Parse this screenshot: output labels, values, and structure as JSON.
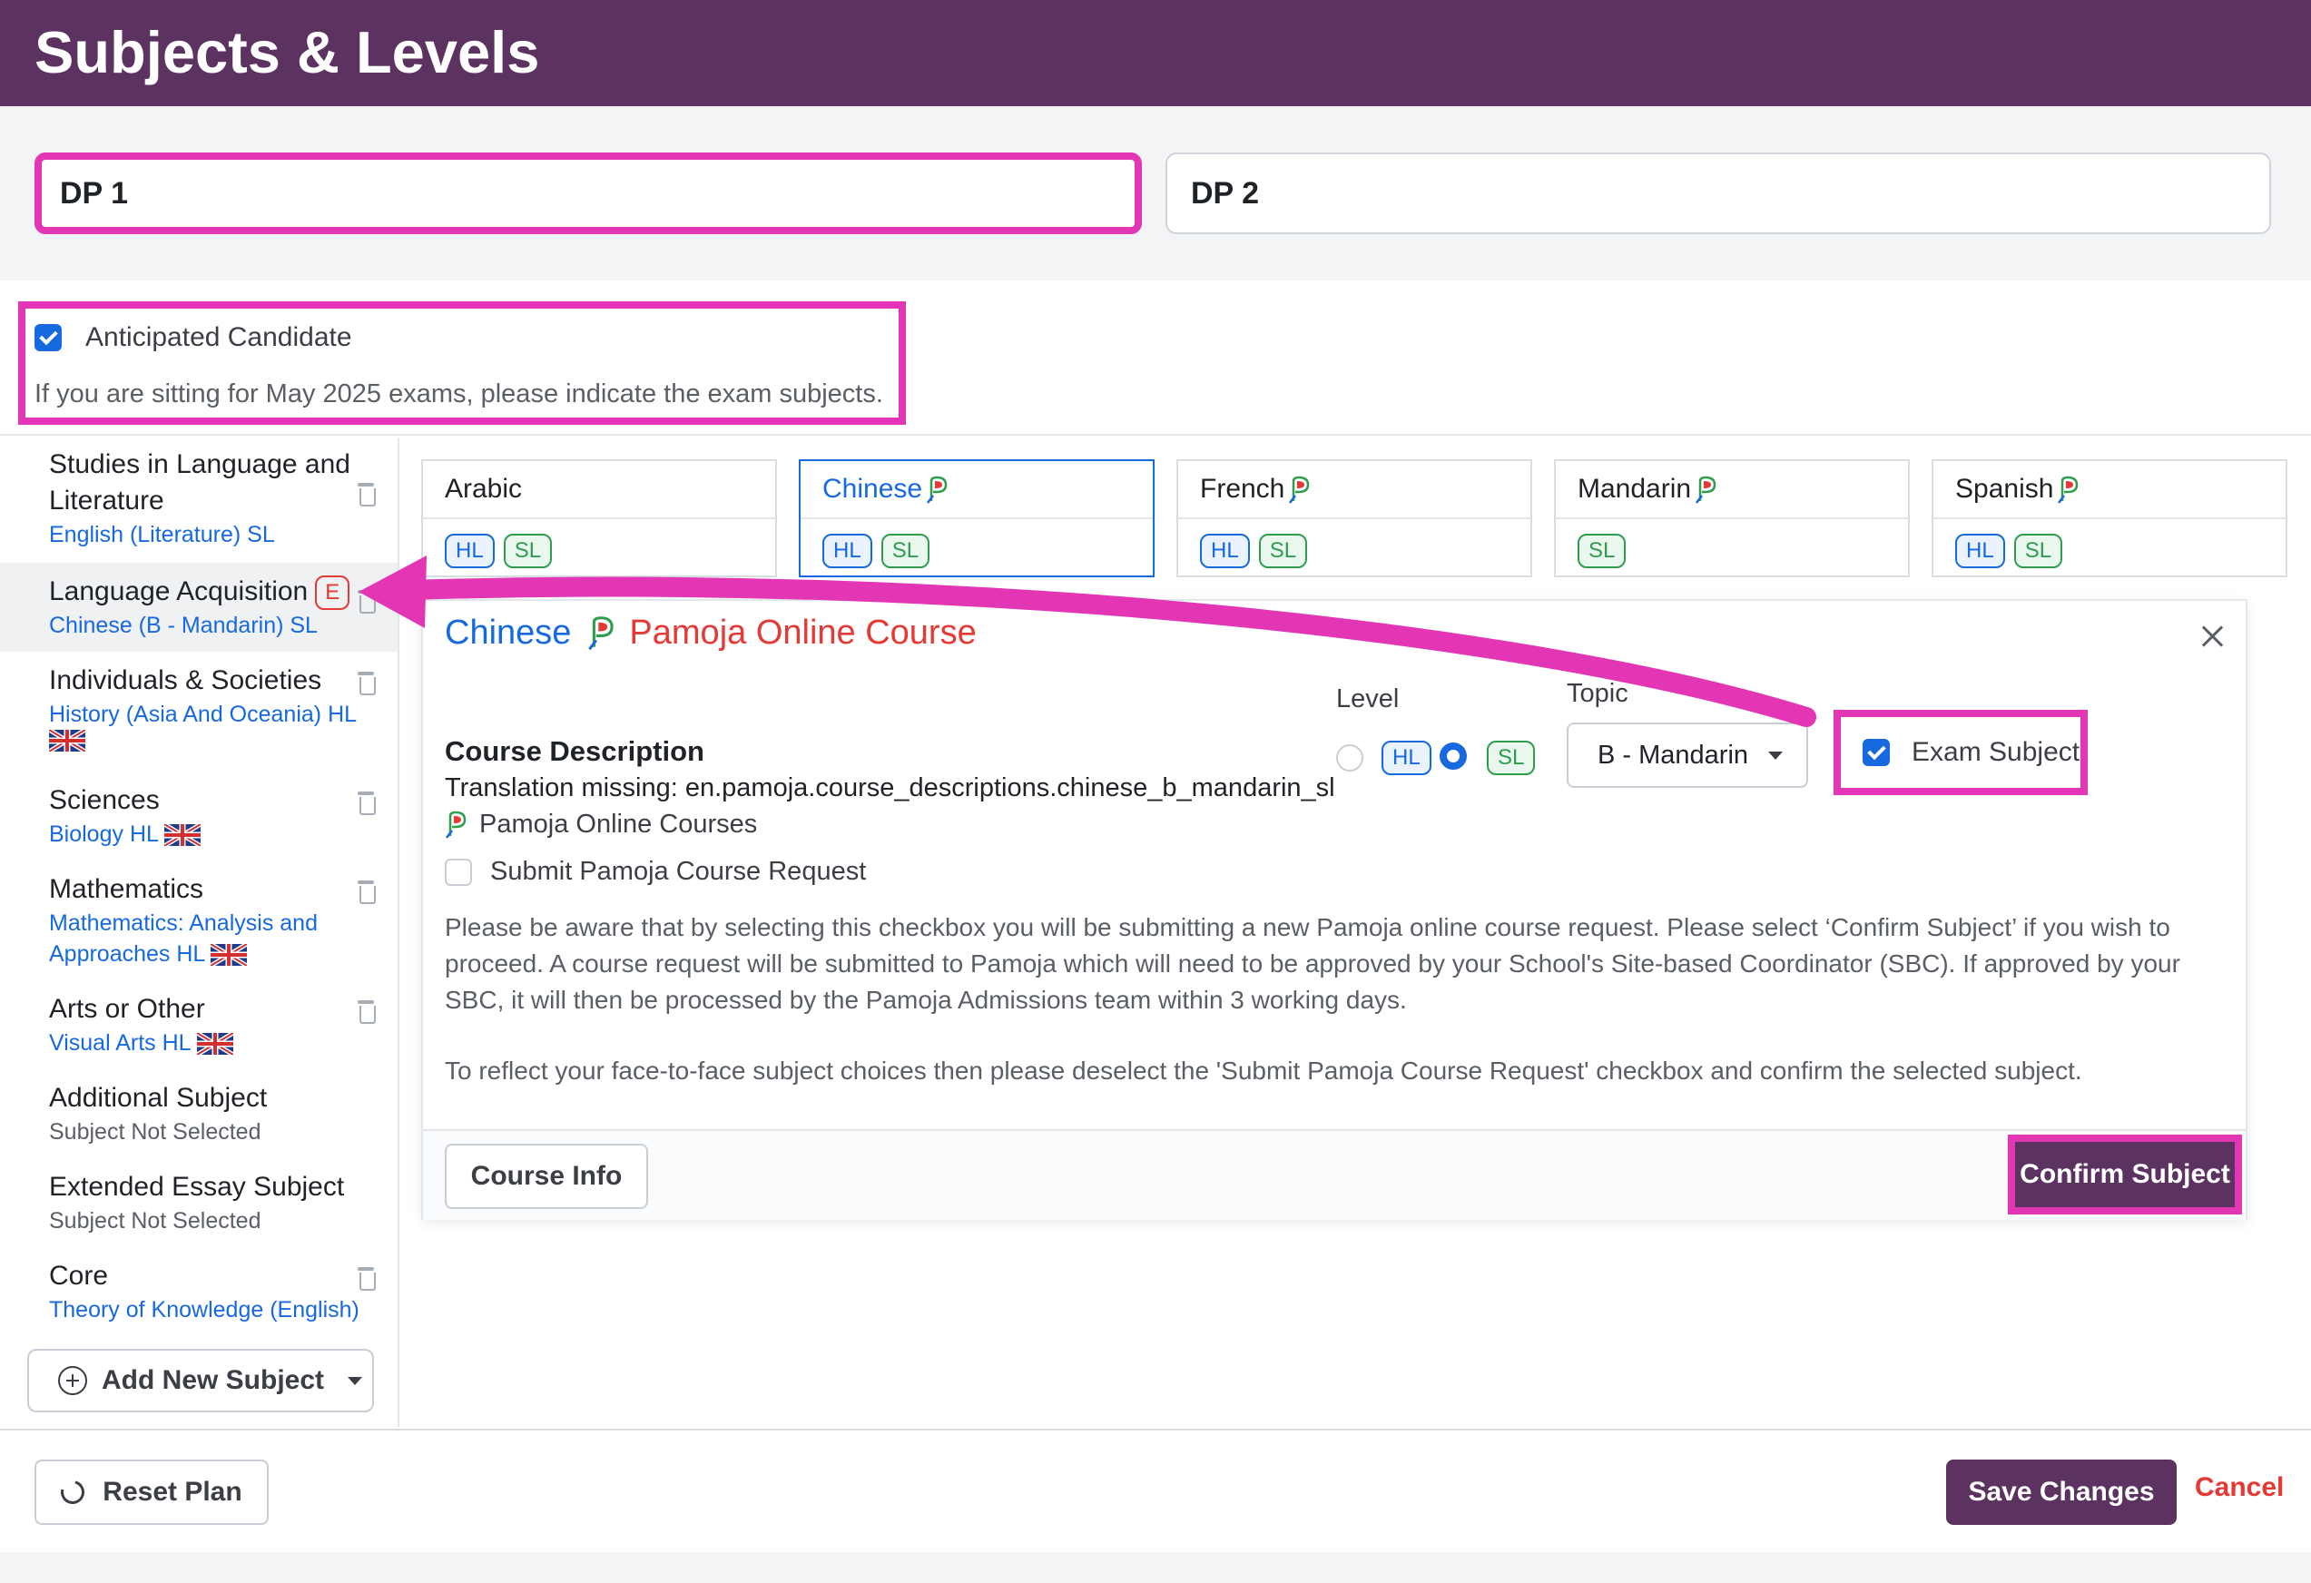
{
  "header": {
    "title": "Subjects & Levels"
  },
  "tabs": [
    {
      "label": "DP 1"
    },
    {
      "label": "DP 2"
    }
  ],
  "anticipated": {
    "label": "Anticipated Candidate",
    "help": "If you are sitting for May 2025 exams, please indicate the exam subjects."
  },
  "sidebar": {
    "items": [
      {
        "title": "Studies in Language and",
        "title2": "Literature",
        "sub": "English (Literature) SL"
      },
      {
        "title": "Language Acquisition",
        "badge": "E",
        "sub": "Chinese (B - Mandarin) SL"
      },
      {
        "title": "Individuals & Societies",
        "sub": "History (Asia And Oceania) HL"
      },
      {
        "title": "Sciences",
        "sub": "Biology HL"
      },
      {
        "title": "Mathematics",
        "sub": "Mathematics: Analysis and",
        "sub2": "Approaches HL"
      },
      {
        "title": "Arts or Other",
        "sub": "Visual Arts HL"
      },
      {
        "title": "Additional Subject",
        "sub": "Subject Not Selected"
      },
      {
        "title": "Extended Essay Subject",
        "sub": "Subject Not Selected"
      },
      {
        "title": "Core",
        "sub": "Theory of Knowledge (English)"
      }
    ],
    "add_label": "Add New Subject"
  },
  "languages": [
    {
      "name": "Arabic",
      "levels": [
        "HL",
        "SL"
      ]
    },
    {
      "name": "Chinese",
      "levels": [
        "HL",
        "SL"
      ]
    },
    {
      "name": "French",
      "levels": [
        "HL",
        "SL"
      ]
    },
    {
      "name": "Mandarin",
      "levels": [
        "SL"
      ]
    },
    {
      "name": "Spanish",
      "levels": [
        "HL",
        "SL"
      ]
    }
  ],
  "panel": {
    "title": "Chinese",
    "pamoja": "Pamoja Online Course",
    "level_label": "Level",
    "topic_label": "Topic",
    "level_hl": "HL",
    "level_sl": "SL",
    "topic_value": "B - Mandarin",
    "exam_subject": "Exam Subject",
    "cd_title": "Course Description",
    "cd_text": "Translation missing: en.pamoja.course_descriptions.chinese_b_mandarin_sl",
    "cd_provider": "Pamoja Online Courses",
    "submit_request": "Submit Pamoja Course Request",
    "para1_l1": "Please be aware that by selecting this checkbox you will be submitting a new Pamoja online course request. Please select ‘Confirm Subject’ if you wish to",
    "para1_l2": "proceed. A course request will be submitted to Pamoja which will need to be approved by your School's Site-based Coordinator (SBC). If approved by your",
    "para1_l3": "SBC, it will then be processed by the Pamoja Admissions team within 3 working days.",
    "para2": "To reflect your face-to-face subject choices then please deselect the 'Submit Pamoja Course Request' checkbox and confirm the selected subject.",
    "course_info": "Course Info",
    "confirm": "Confirm Subject"
  },
  "footer": {
    "reset": "Reset Plan",
    "save": "Save Changes",
    "cancel": "Cancel"
  },
  "colors": {
    "brand": "#5c3360",
    "accent": "#1769e0",
    "highlight": "#e236b5",
    "danger": "#e53935",
    "sl_green": "#2e9d4e"
  }
}
